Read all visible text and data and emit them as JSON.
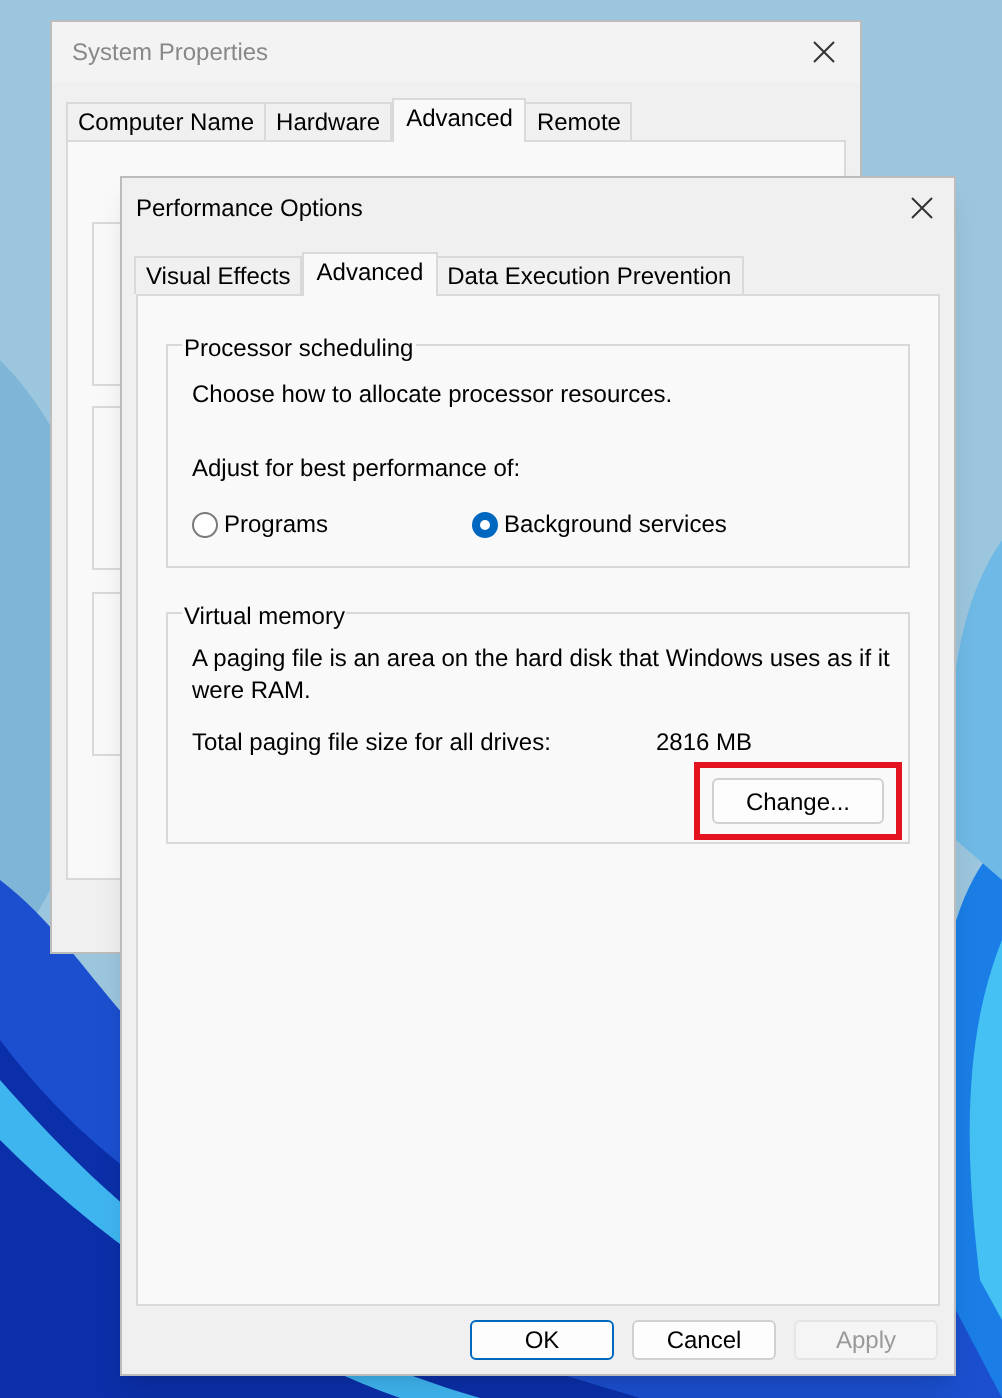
{
  "back_window": {
    "title": "System Properties",
    "tabs": [
      {
        "label": "Computer Name",
        "selected": false
      },
      {
        "label": "Hardware",
        "selected": false
      },
      {
        "label": "Advanced",
        "selected": true
      },
      {
        "label": "Remote",
        "selected": false
      }
    ]
  },
  "dialog": {
    "title": "Performance Options",
    "tabs": [
      {
        "label": "Visual Effects",
        "selected": false
      },
      {
        "label": "Advanced",
        "selected": true
      },
      {
        "label": "Data Execution Prevention",
        "selected": false
      }
    ],
    "processor_scheduling": {
      "title": "Processor scheduling",
      "description": "Choose how to allocate processor resources.",
      "prompt": "Adjust for best performance of:",
      "options": [
        {
          "label": "Programs",
          "selected": false
        },
        {
          "label": "Background services",
          "selected": true
        }
      ]
    },
    "virtual_memory": {
      "title": "Virtual memory",
      "description": "A paging file is an area on the hard disk that Windows uses as if it were RAM.",
      "size_label": "Total paging file size for all drives:",
      "size_value": "2816 MB",
      "change_button": {
        "label": "Change...",
        "highlighted": true
      }
    },
    "buttons": [
      {
        "label": "OK",
        "kind": "default",
        "disabled": false
      },
      {
        "label": "Cancel",
        "kind": "normal",
        "disabled": false
      },
      {
        "label": "Apply",
        "kind": "normal",
        "disabled": true
      }
    ]
  }
}
